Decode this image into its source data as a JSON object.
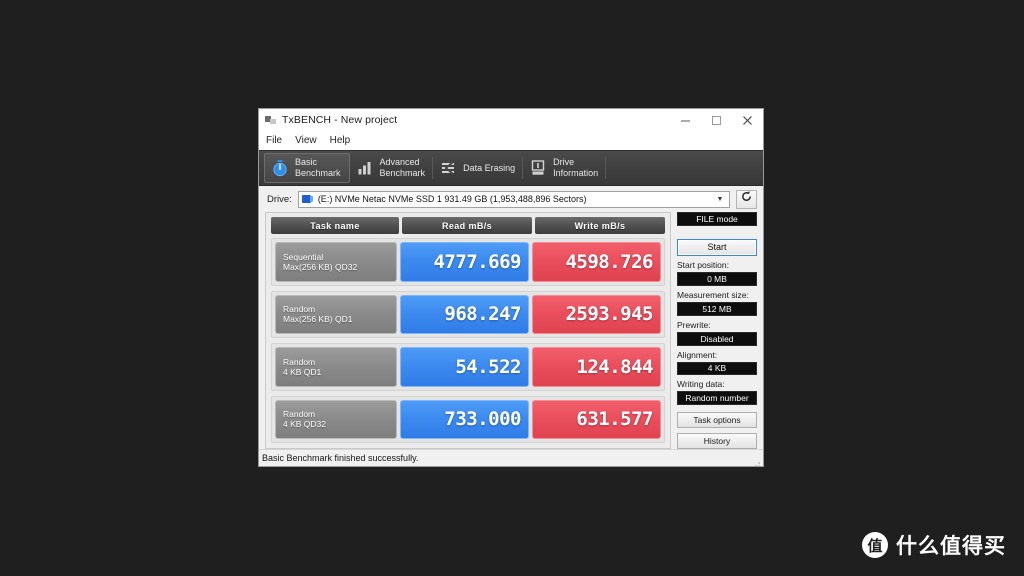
{
  "window": {
    "title": "TxBENCH - New project",
    "app_icon": "app-icon",
    "controls": {
      "minimize": "minimize-icon",
      "maximize": "maximize-icon",
      "close": "close-icon"
    }
  },
  "menu": {
    "items": [
      {
        "label": "File"
      },
      {
        "label": "View"
      },
      {
        "label": "Help"
      }
    ]
  },
  "tabs": [
    {
      "label": "Basic\nBenchmark",
      "icon": "stopwatch-icon",
      "active": true
    },
    {
      "label": "Advanced\nBenchmark",
      "icon": "bar-chart-icon",
      "active": false
    },
    {
      "label": "Data Erasing",
      "icon": "erase-icon",
      "active": false
    },
    {
      "label": "Drive\nInformation",
      "icon": "drive-info-icon",
      "active": false
    }
  ],
  "drive": {
    "label": "Drive:",
    "selected": "(E:) NVMe Netac NVMe SSD 1  931.49 GB (1,953,488,896 Sectors)",
    "dropdown_arrow": "chevron-down-icon",
    "refresh_icon": "refresh-icon"
  },
  "results": {
    "columns": [
      "Task name",
      "Read mB/s",
      "Write mB/s"
    ],
    "rows": [
      {
        "name_line1": "Sequential",
        "name_line2": "Max(256 KB) QD32",
        "read": "4777.669",
        "write": "4598.726"
      },
      {
        "name_line1": "Random",
        "name_line2": "Max(256 KB) QD1",
        "read": "968.247",
        "write": "2593.945"
      },
      {
        "name_line1": "Random",
        "name_line2": "4 KB QD1",
        "read": "54.522",
        "write": "124.844"
      },
      {
        "name_line1": "Random",
        "name_line2": "4 KB QD32",
        "read": "733.000",
        "write": "631.577"
      }
    ]
  },
  "side_panel": {
    "mode_value": "FILE mode",
    "start_label": "Start",
    "start_position_label": "Start position:",
    "start_position_value": "0 MB",
    "measurement_size_label": "Measurement size:",
    "measurement_size_value": "512 MB",
    "prewrite_label": "Prewrite:",
    "prewrite_value": "Disabled",
    "alignment_label": "Alignment:",
    "alignment_value": "4 KB",
    "writing_data_label": "Writing data:",
    "writing_data_value": "Random number",
    "task_options_label": "Task options",
    "history_label": "History"
  },
  "status": {
    "text": "Basic Benchmark finished successfully."
  },
  "watermark": {
    "badge": "值",
    "text": "什么值得买"
  },
  "colors": {
    "read_bar": "#3d8bef",
    "write_bar": "#ea4f5d",
    "toolbar_dark": "#414141",
    "task_cell": "#8a8a8a",
    "accent_blue": "#3f87d6",
    "page_background": "#1f1f1f"
  }
}
